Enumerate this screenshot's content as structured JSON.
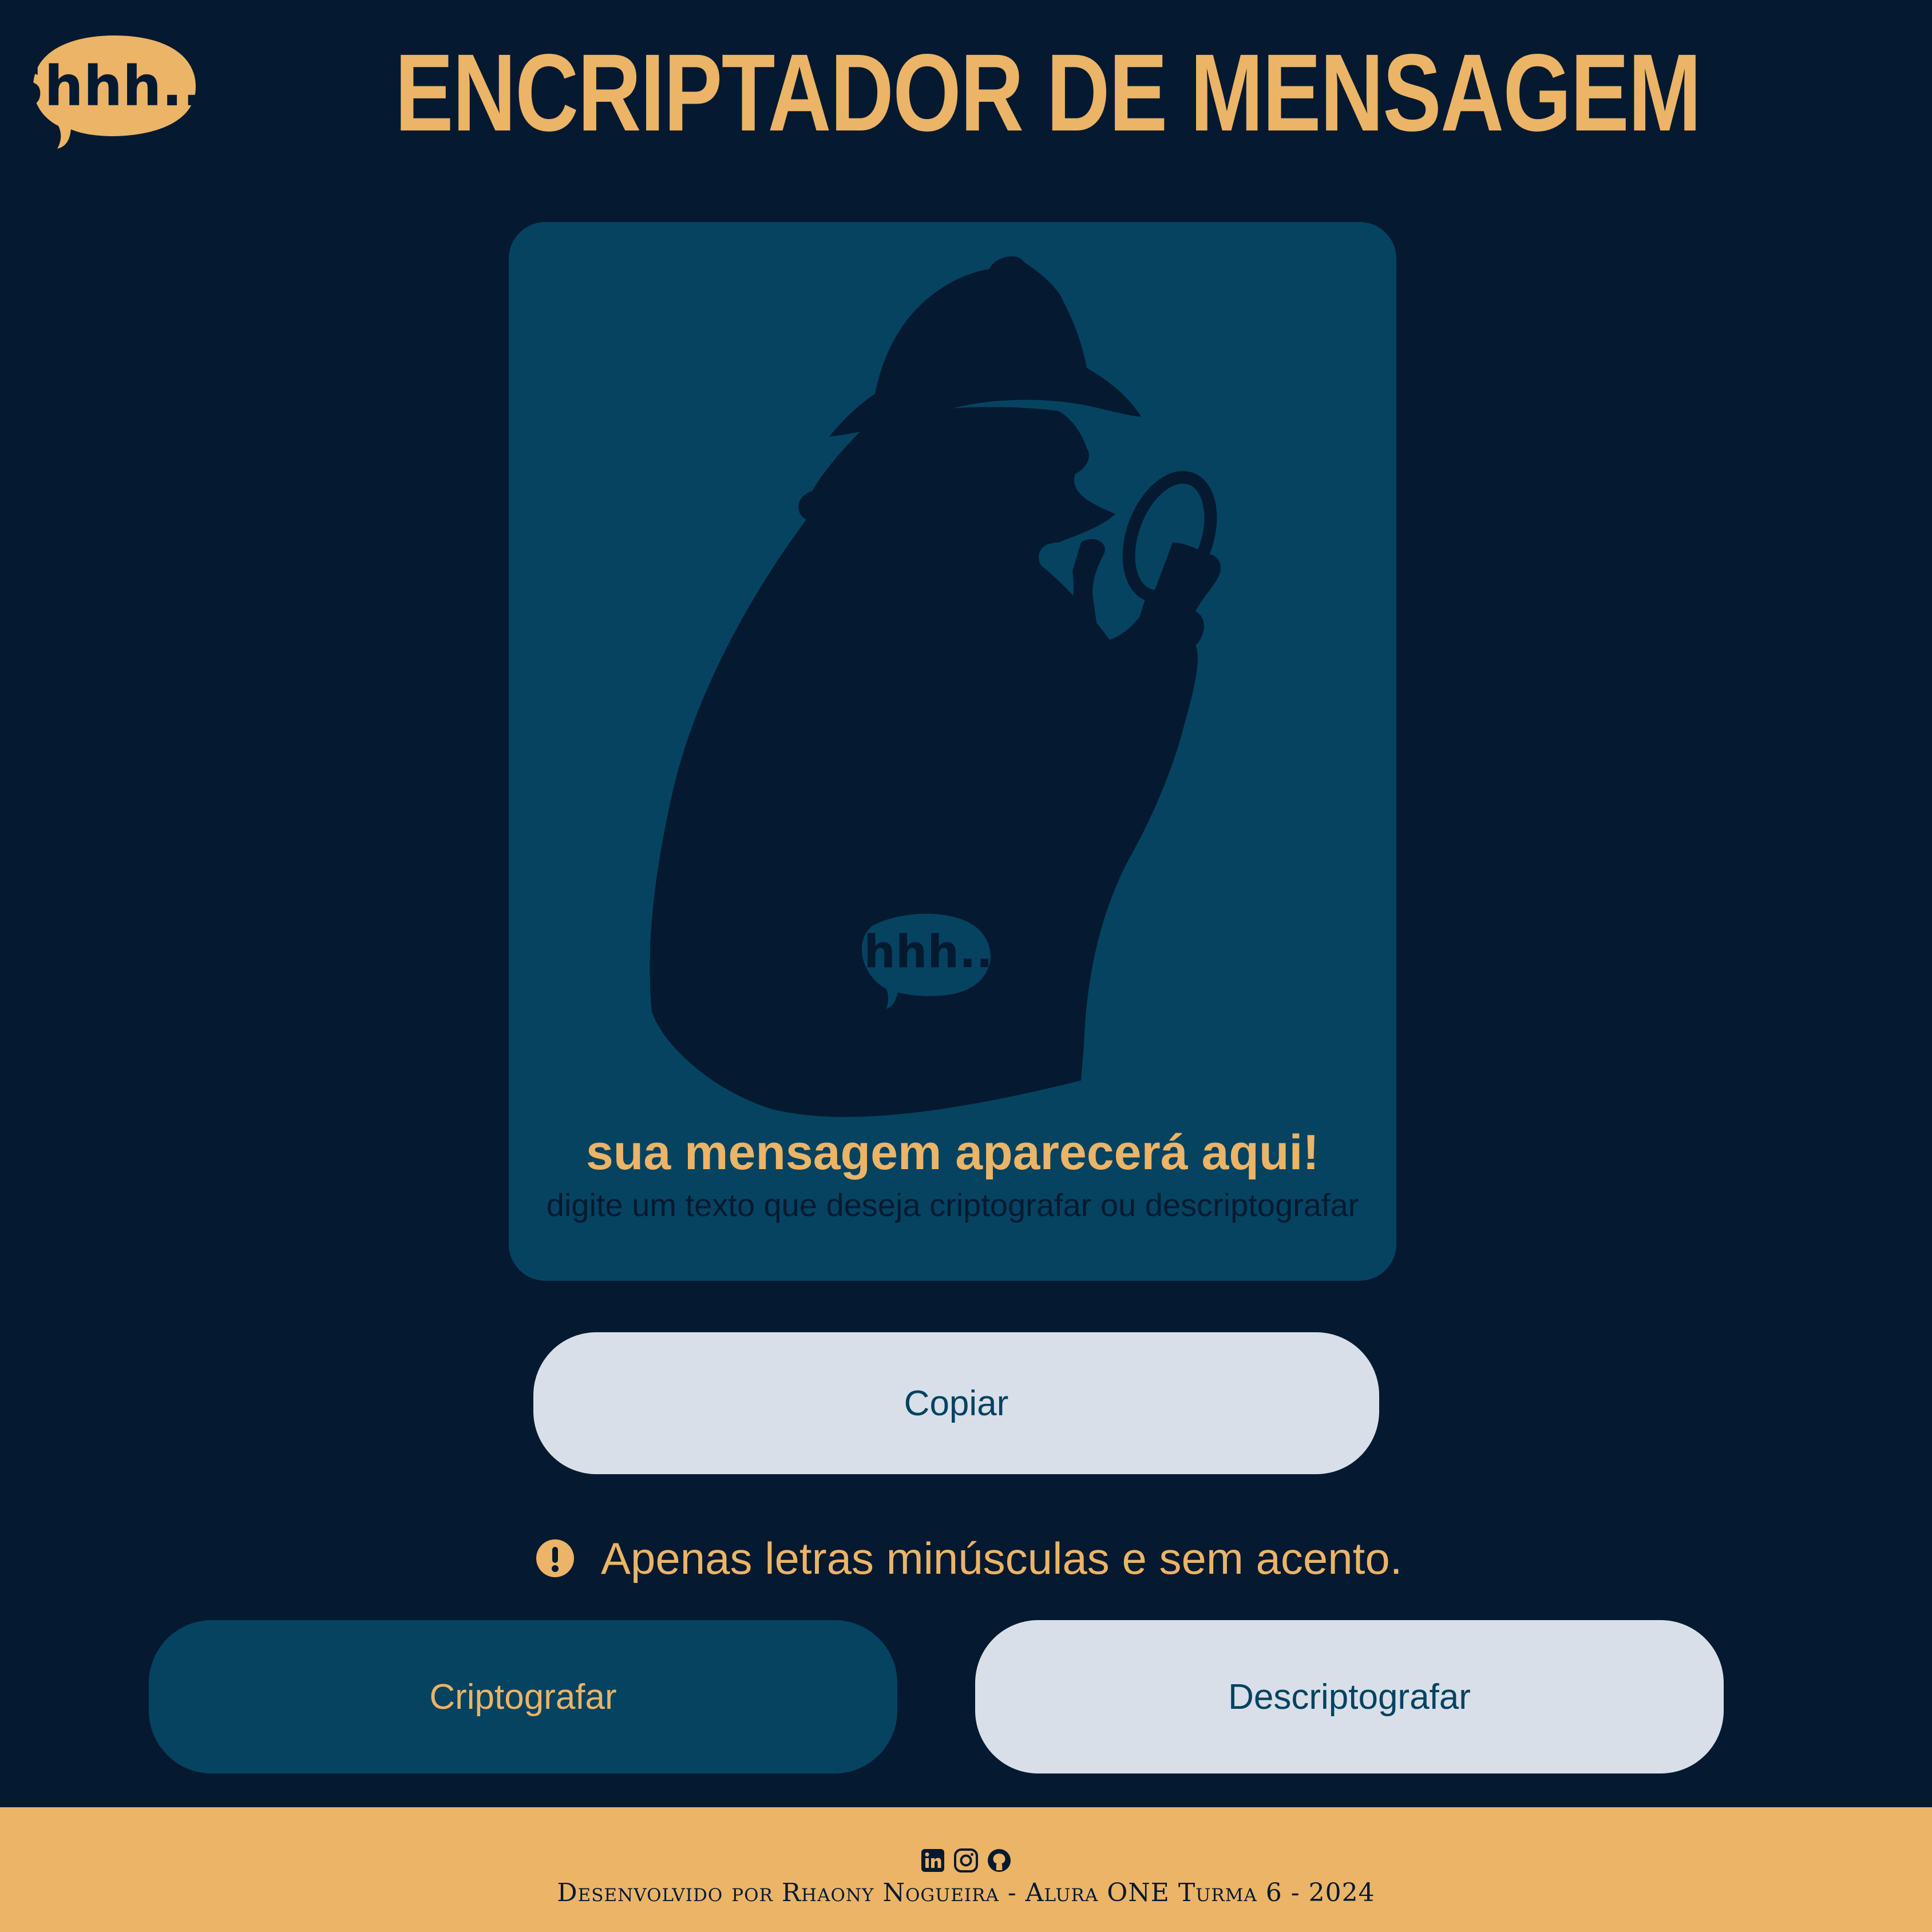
{
  "header": {
    "logo_text": "Shhh...",
    "title": "ENCRIPTADOR DE MENSAGEM"
  },
  "output": {
    "illustration": "detective-silhouette-with-magnifier",
    "badge_text": "Shhh...",
    "title": "sua mensagem aparecerá aqui!",
    "subtitle": "digite um texto que deseja criptografar ou descriptografar"
  },
  "actions": {
    "copy_label": "Copiar",
    "encrypt_label": "Criptografar",
    "decrypt_label": "Descriptografar"
  },
  "notice": {
    "icon": "exclamation-circle-icon",
    "text": "Apenas letras minúsculas e sem acento."
  },
  "footer": {
    "social": [
      "linkedin-icon",
      "instagram-icon",
      "github-icon"
    ],
    "credits": "Desenvolvido por Rhaony Nogueira - Alura ONE Turma 6 - 2024"
  },
  "colors": {
    "background": "#051a30",
    "accent": "#ebb467",
    "card": "#064361",
    "light_button": "#d8dfe9"
  }
}
